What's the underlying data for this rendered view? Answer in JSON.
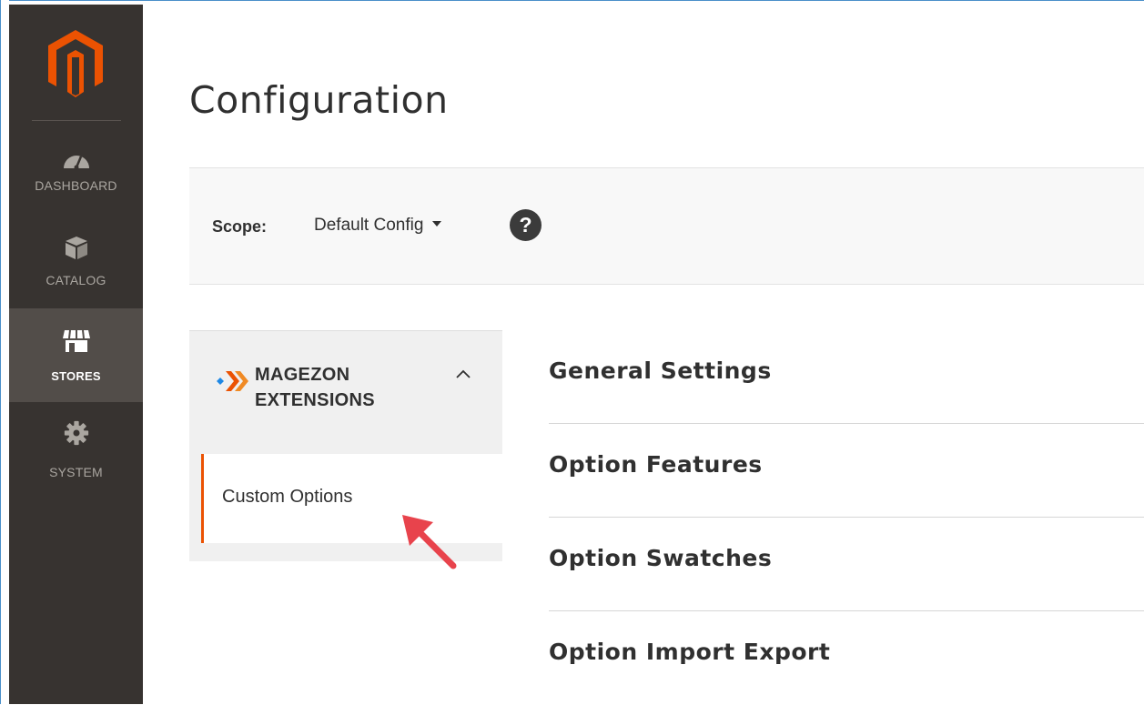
{
  "colors": {
    "sidebar_bg": "#373330",
    "sidebar_active_bg": "#524d49",
    "brand_orange": "#eb5202",
    "arrow_red": "#e8434c"
  },
  "sidebar": {
    "logo_icon": "magento-logo-icon",
    "items": [
      {
        "label": "DASHBOARD",
        "icon": "gauge-icon",
        "active": false
      },
      {
        "label": "CATALOG",
        "icon": "box-icon",
        "active": false
      },
      {
        "label": "STORES",
        "icon": "storefront-icon",
        "active": true
      },
      {
        "label": "SYSTEM",
        "icon": "gear-icon",
        "active": false
      }
    ]
  },
  "page": {
    "title": "Configuration"
  },
  "scope": {
    "label": "Scope:",
    "selected": "Default Config",
    "help_icon": "question-circle-icon",
    "help_glyph": "?"
  },
  "config_tabs": {
    "group": {
      "title_line1": "MAGEZON",
      "title_line2": "EXTENSIONS",
      "logo_icon": "magezon-logo-icon",
      "expanded": true
    },
    "items": [
      {
        "label": "Custom Options",
        "active": true
      }
    ]
  },
  "sections": [
    {
      "title": "General Settings"
    },
    {
      "title": "Option Features"
    },
    {
      "title": "Option Swatches"
    },
    {
      "title": "Option Import Export"
    }
  ]
}
